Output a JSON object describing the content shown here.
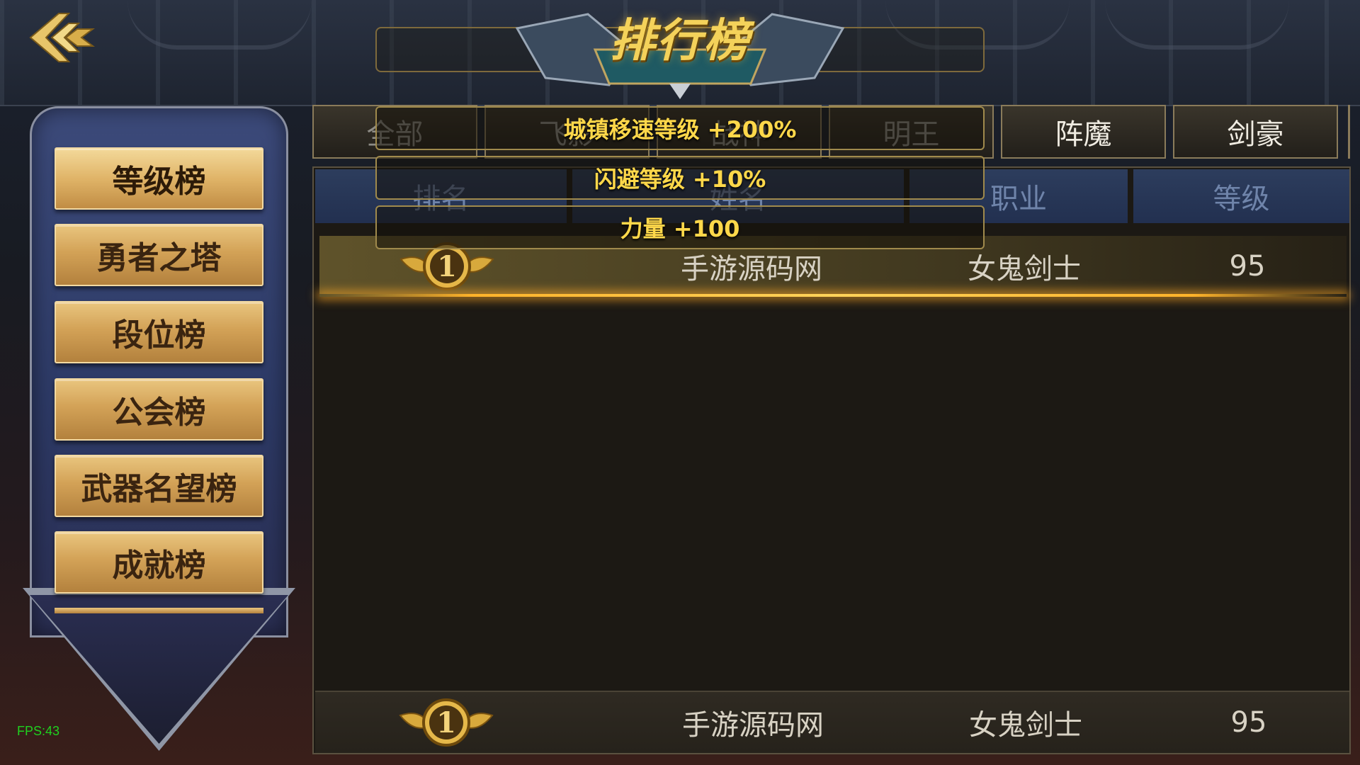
{
  "header": {
    "title": "排行榜"
  },
  "sidebar": {
    "items": [
      {
        "label": "等级榜",
        "active": true
      },
      {
        "label": "勇者之塔",
        "active": false
      },
      {
        "label": "段位榜",
        "active": false
      },
      {
        "label": "公会榜",
        "active": false
      },
      {
        "label": "武器名望榜",
        "active": false
      },
      {
        "label": "成就榜",
        "active": false
      }
    ]
  },
  "tabs": [
    {
      "label": "全部"
    },
    {
      "label": "飞影"
    },
    {
      "label": "战神"
    },
    {
      "label": "明王"
    },
    {
      "label": "阵魔"
    },
    {
      "label": "剑豪"
    }
  ],
  "table": {
    "headers": {
      "rank": "排名",
      "name": "姓名",
      "class": "职业",
      "level": "等级"
    },
    "rows": [
      {
        "rank": "1",
        "name": "手游源码网",
        "class": "女鬼剑士",
        "level": "95"
      }
    ],
    "self_row": {
      "rank": "1",
      "name": "手游源码网",
      "class": "女鬼剑士",
      "level": "95"
    }
  },
  "buffs": [
    "城镇移速等级 +200%",
    "闪避等级 +10%",
    "力量 +100"
  ],
  "status": {
    "fps": "FPS:43"
  },
  "colors": {
    "gold_button": "#d3a257",
    "header_blue": "#2d3d5d",
    "buff_text": "#ffd84a",
    "fps_green": "#1fd11f"
  }
}
